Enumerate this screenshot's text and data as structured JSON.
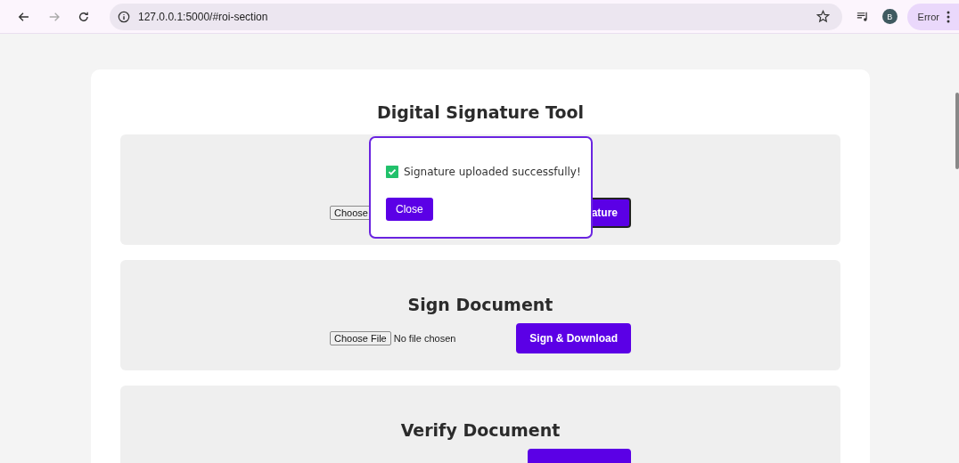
{
  "browser": {
    "url": "127.0.0.1:5000/#roi-section",
    "forward_disabled": true,
    "avatar": "B",
    "profile_label": "Error"
  },
  "page": {
    "title": "Digital Signature Tool"
  },
  "sections": [
    {
      "file_button": "Choose",
      "action": "ature",
      "action_focused": true
    },
    {
      "heading": "Sign Document",
      "file_button": "Choose File",
      "file_status": "No file chosen",
      "action": "Sign & Download",
      "action_focused": false
    },
    {
      "heading": "Verify Document",
      "action_focused": false
    }
  ],
  "dialog": {
    "message": "Signature uploaded successfully!",
    "checked": true,
    "button": "Close"
  }
}
